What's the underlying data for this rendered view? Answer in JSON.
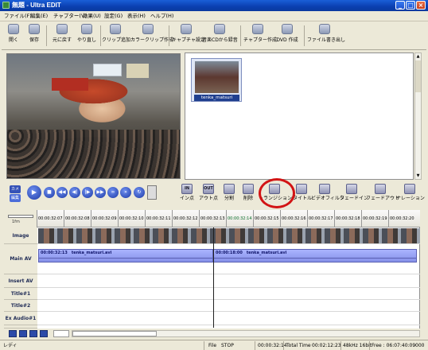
{
  "window": {
    "title": "無題 - Ultra EDIT",
    "controls": [
      "_",
      "□",
      "×"
    ]
  },
  "menu": [
    "ファイル(F)",
    "編集(E)",
    "チャプター(V)",
    "効果(U)",
    "設定(G)",
    "表示(H)",
    "ヘルプ(H)"
  ],
  "toolbar": {
    "open": "開く",
    "save": "保存",
    "undo": "元に戻す",
    "redo": "やり直し",
    "add_clip": "クリップ追加",
    "color_clip": "カラークリップ作成",
    "capture_settings": "キャプチャ設定",
    "cd_record": "音楽CDから録音",
    "chapter_create": "チャプター作成",
    "dvd_create": "DVD 作成",
    "file_export": "ファイル書き出し"
  },
  "bin": {
    "clip_name": "tenka_matsuri"
  },
  "transport": {
    "camera_label": "カメラ",
    "edit_label": "編集"
  },
  "edit_tools": {
    "in_icon": "IN",
    "in_label": "イン点",
    "out_icon": "OUT",
    "out_label": "アウト点",
    "split": "分割",
    "delete": "削除",
    "transition": "トランジション",
    "title": "タイトル",
    "video_filter": "ビデオフィルタ",
    "fade_in": "フェードイン",
    "fade_out": "フェードアウト",
    "narration": "ナレーション"
  },
  "timeline": {
    "zoom_label": "1fm",
    "timecodes": [
      "00:00:32:07",
      "00:00:32:08",
      "00:00:32:09",
      "00:00:32:10",
      "00:00:32:11",
      "00:00:32:12",
      "00:00:32:13",
      "00:00:32:14",
      "00:00:32:15",
      "00:00:32:16",
      "00:00:32:17",
      "00:00:32:18",
      "00:00:32:19",
      "00:00:32:20"
    ],
    "tracks": [
      "Image",
      "Main AV",
      "Insert AV",
      "Title#1",
      "Title#2",
      "Ex Audio#1"
    ],
    "clip1_label": "00:00:32:13　tenka_matsuri.avi",
    "clip2_label": "00:00:18:00　tenka_matsuri.avi"
  },
  "status": {
    "ready": "レディ",
    "file": "File",
    "state": "STOP",
    "position": "00:00:32:14",
    "total_label": "Total Time",
    "total_value": "00:02:12:23",
    "audio": "48kHz 16bit",
    "free": "Free : 06:07:40:09",
    "counter": "000"
  },
  "colors": {
    "titlebar": "#0a3fb0",
    "highlight_circle": "#d21414",
    "clip": "#8590e8",
    "track_label": "#1e2a55"
  }
}
